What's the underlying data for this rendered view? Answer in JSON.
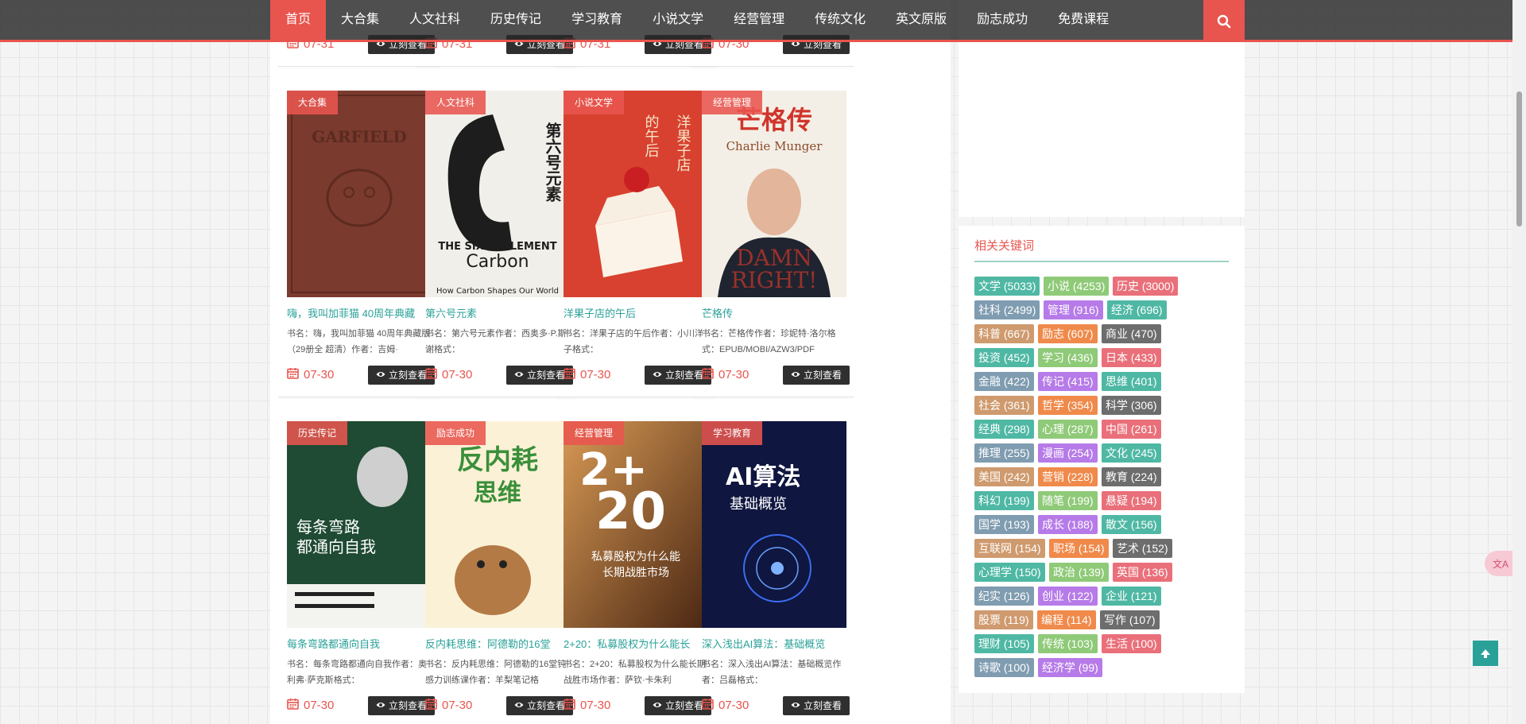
{
  "nav": {
    "items": [
      "首页",
      "大合集",
      "人文社科",
      "历史传记",
      "学习教育",
      "小说文学",
      "经营管理",
      "传统文化",
      "英文原版",
      "励志成功",
      "免费课程"
    ],
    "active_index": 0,
    "search_icon": "search-icon"
  },
  "top_row": {
    "dates": [
      "07-31",
      "07-31",
      "07-31",
      "07-30"
    ],
    "button_label": "立刻查看"
  },
  "cards": [
    {
      "category": "大合集",
      "title": "嗨，我叫加菲猫 40周年典藏",
      "desc": "书名：嗨，我叫加菲猫 40周年典藏版（29册全 超清）作者：吉姆·",
      "date": "07-30",
      "button": "立刻查看",
      "cover_text": "GARFIELD"
    },
    {
      "category": "人文社科",
      "title": "第六号元素",
      "desc": "书名：第六号元素作者：西奥多·P.斯谢格式：",
      "date": "07-30",
      "button": "立刻查看",
      "cover_text": "第六号元素"
    },
    {
      "category": "小说文学",
      "title": "洋果子店的午后",
      "desc": "书名：洋果子店的午后作者：小川洋子格式：",
      "date": "07-30",
      "button": "立刻查看",
      "cover_text": "洋果子店的午后"
    },
    {
      "category": "经营管理",
      "title": "芒格传",
      "desc": "书名：芒格传作者：珍妮特·洛尔格式：EPUB/MOBI/AZW3/PDF",
      "date": "07-30",
      "button": "立刻查看",
      "cover_text": "芒格传"
    },
    {
      "category": "历史传记",
      "title": "每条弯路都通向自我",
      "desc": "书名：每条弯路都通向自我作者：奥利弗·萨克斯格式：",
      "date": "07-30",
      "button": "立刻查看",
      "cover_text": "每条弯路都通向自我"
    },
    {
      "category": "励志成功",
      "title": "反内耗思维：阿德勒的16堂",
      "desc": "书名：反内耗思维：阿德勒的16堂钝感力训练课作者：羊梨笔记格",
      "date": "07-30",
      "button": "立刻查看",
      "cover_text": "反内耗思维"
    },
    {
      "category": "经营管理",
      "title": "2+20：私募股权为什么能长",
      "desc": "书名：2+20：私募股权为什么能长期战胜市场作者：萨钦·卡朱利",
      "date": "07-30",
      "button": "立刻查看",
      "cover_text": "2+20"
    },
    {
      "category": "学习教育",
      "title": "深入浅出AI算法：基础概览",
      "desc": "书名：深入浅出AI算法：基础概览作者：吕磊格式：",
      "date": "07-30",
      "button": "立刻查看",
      "cover_text": "深入浅出AI算法 基础概览"
    }
  ],
  "keywords": {
    "title": "相关关键词",
    "tags": [
      {
        "label": "文学 (5033)",
        "color": "#4fb8a4"
      },
      {
        "label": "小说 (4253)",
        "color": "#8fca78"
      },
      {
        "label": "历史 (3000)",
        "color": "#e9707a"
      },
      {
        "label": "社科 (2499)",
        "color": "#7f9cb0"
      },
      {
        "label": "管理 (916)",
        "color": "#b67be8"
      },
      {
        "label": "经济 (696)",
        "color": "#4fb8a4"
      },
      {
        "label": "科普 (667)",
        "color": "#cf9a6e"
      },
      {
        "label": "励志 (607)",
        "color": "#f08a4b"
      },
      {
        "label": "商业 (470)",
        "color": "#6d6d6d"
      },
      {
        "label": "投资 (452)",
        "color": "#4fb8a4"
      },
      {
        "label": "学习 (436)",
        "color": "#8fca78"
      },
      {
        "label": "日本 (433)",
        "color": "#e9707a"
      },
      {
        "label": "金融 (422)",
        "color": "#7f9cb0"
      },
      {
        "label": "传记 (415)",
        "color": "#b67be8"
      },
      {
        "label": "思维 (401)",
        "color": "#4fb8a4"
      },
      {
        "label": "社会 (361)",
        "color": "#cf9a6e"
      },
      {
        "label": "哲学 (354)",
        "color": "#f08a4b"
      },
      {
        "label": "科学 (306)",
        "color": "#6d6d6d"
      },
      {
        "label": "经典 (298)",
        "color": "#4fb8a4"
      },
      {
        "label": "心理 (287)",
        "color": "#8fca78"
      },
      {
        "label": "中国 (261)",
        "color": "#e9707a"
      },
      {
        "label": "推理 (255)",
        "color": "#7f9cb0"
      },
      {
        "label": "漫画 (254)",
        "color": "#b67be8"
      },
      {
        "label": "文化 (245)",
        "color": "#4fb8a4"
      },
      {
        "label": "美国 (242)",
        "color": "#cf9a6e"
      },
      {
        "label": "营销 (228)",
        "color": "#f08a4b"
      },
      {
        "label": "教育 (224)",
        "color": "#6d6d6d"
      },
      {
        "label": "科幻 (199)",
        "color": "#4fb8a4"
      },
      {
        "label": "随笔 (199)",
        "color": "#8fca78"
      },
      {
        "label": "悬疑 (194)",
        "color": "#e9707a"
      },
      {
        "label": "国学 (193)",
        "color": "#7f9cb0"
      },
      {
        "label": "成长 (188)",
        "color": "#b67be8"
      },
      {
        "label": "散文 (156)",
        "color": "#4fb8a4"
      },
      {
        "label": "互联网 (154)",
        "color": "#cf9a6e"
      },
      {
        "label": "职场 (154)",
        "color": "#f08a4b"
      },
      {
        "label": "艺术 (152)",
        "color": "#6d6d6d"
      },
      {
        "label": "心理学 (150)",
        "color": "#4fb8a4"
      },
      {
        "label": "政治 (139)",
        "color": "#8fca78"
      },
      {
        "label": "英国 (136)",
        "color": "#e9707a"
      },
      {
        "label": "纪实 (126)",
        "color": "#7f9cb0"
      },
      {
        "label": "创业 (122)",
        "color": "#b67be8"
      },
      {
        "label": "企业 (121)",
        "color": "#4fb8a4"
      },
      {
        "label": "股票 (119)",
        "color": "#cf9a6e"
      },
      {
        "label": "编程 (114)",
        "color": "#f08a4b"
      },
      {
        "label": "写作 (107)",
        "color": "#6d6d6d"
      },
      {
        "label": "理财 (105)",
        "color": "#4fb8a4"
      },
      {
        "label": "传统 (103)",
        "color": "#8fca78"
      },
      {
        "label": "生活 (100)",
        "color": "#e9707a"
      },
      {
        "label": "诗歌 (100)",
        "color": "#7f9cb0"
      },
      {
        "label": "经济学 (99)",
        "color": "#b67be8"
      }
    ]
  },
  "colors": {
    "accent": "#e8554e",
    "teal": "#2aa198",
    "dark": "#2f2f2f"
  },
  "icons": {
    "calendar": "calendar-icon",
    "eye": "eye-icon",
    "back_to_top": "arrow-up-icon",
    "translate": "translate-icon"
  }
}
